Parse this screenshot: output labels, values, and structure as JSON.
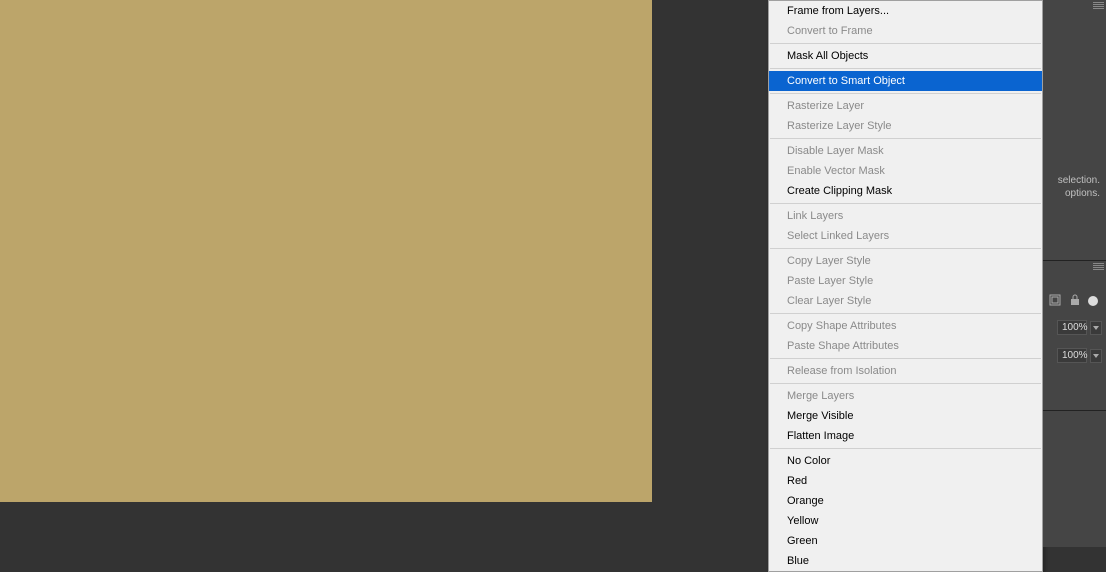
{
  "menu": {
    "items": [
      {
        "label": "Frame from Layers...",
        "enabled": true
      },
      {
        "label": "Convert to Frame",
        "enabled": false
      },
      {
        "separator": true
      },
      {
        "label": "Mask All Objects",
        "enabled": true
      },
      {
        "separator": true
      },
      {
        "label": "Convert to Smart Object",
        "enabled": true,
        "highlighted": true
      },
      {
        "separator": true
      },
      {
        "label": "Rasterize Layer",
        "enabled": false
      },
      {
        "label": "Rasterize Layer Style",
        "enabled": false
      },
      {
        "separator": true
      },
      {
        "label": "Disable Layer Mask",
        "enabled": false
      },
      {
        "label": "Enable Vector Mask",
        "enabled": false
      },
      {
        "label": "Create Clipping Mask",
        "enabled": true
      },
      {
        "separator": true
      },
      {
        "label": "Link Layers",
        "enabled": false
      },
      {
        "label": "Select Linked Layers",
        "enabled": false
      },
      {
        "separator": true
      },
      {
        "label": "Copy Layer Style",
        "enabled": false
      },
      {
        "label": "Paste Layer Style",
        "enabled": false
      },
      {
        "label": "Clear Layer Style",
        "enabled": false
      },
      {
        "separator": true
      },
      {
        "label": "Copy Shape Attributes",
        "enabled": false
      },
      {
        "label": "Paste Shape Attributes",
        "enabled": false
      },
      {
        "separator": true
      },
      {
        "label": "Release from Isolation",
        "enabled": false
      },
      {
        "separator": true
      },
      {
        "label": "Merge Layers",
        "enabled": false
      },
      {
        "label": "Merge Visible",
        "enabled": true
      },
      {
        "label": "Flatten Image",
        "enabled": true
      },
      {
        "separator": true
      },
      {
        "label": "No Color",
        "enabled": true
      },
      {
        "label": "Red",
        "enabled": true
      },
      {
        "label": "Orange",
        "enabled": true
      },
      {
        "label": "Yellow",
        "enabled": true
      },
      {
        "label": "Green",
        "enabled": true
      },
      {
        "label": "Blue",
        "enabled": true
      }
    ]
  },
  "panel": {
    "hint1": "selection.",
    "hint2": "options.",
    "opacity1": "100%",
    "opacity2": "100%"
  }
}
